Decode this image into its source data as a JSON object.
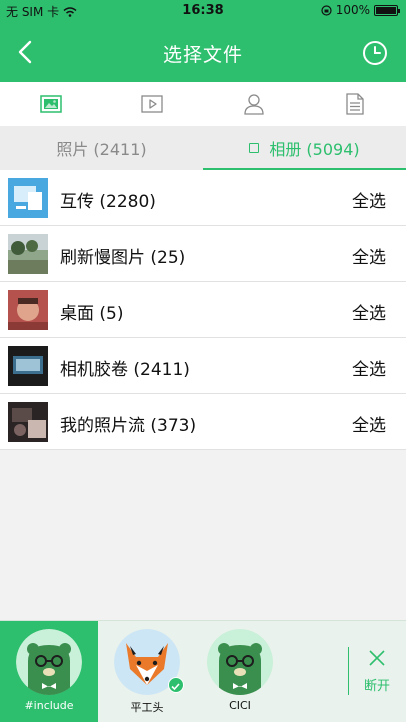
{
  "status_bar": {
    "carrier": "无 SIM 卡",
    "time": "16:38",
    "battery": "100%"
  },
  "header": {
    "title": "选择文件",
    "back_icon": "chevron-left-icon",
    "history_icon": "clock-icon"
  },
  "type_tabs": [
    {
      "icon": "image-icon",
      "active": true
    },
    {
      "icon": "video-icon",
      "active": false
    },
    {
      "icon": "contact-icon",
      "active": false
    },
    {
      "icon": "document-icon",
      "active": false
    }
  ],
  "segments": {
    "photos": "照片 (2411)",
    "albums": "相册 (5094)"
  },
  "albums": [
    {
      "name": "互传 (2280)",
      "action": "全选"
    },
    {
      "name": "刷新慢图片 (25)",
      "action": "全选"
    },
    {
      "name": "桌面 (5)",
      "action": "全选"
    },
    {
      "name": "相机胶卷 (2411)",
      "action": "全选"
    },
    {
      "name": "我的照片流 (373)",
      "action": "全选"
    }
  ],
  "devices": [
    {
      "name": "#include",
      "avatar": "bear-avatar",
      "selected": true
    },
    {
      "name": "平工头",
      "avatar": "fox-avatar",
      "selected": false,
      "connected": true
    },
    {
      "name": "CICI",
      "avatar": "bear-avatar",
      "selected": false
    }
  ],
  "disconnect": {
    "label": "断开",
    "icon": "close-icon"
  },
  "colors": {
    "accent": "#2dbf6e",
    "background": "#f2f2f2"
  }
}
